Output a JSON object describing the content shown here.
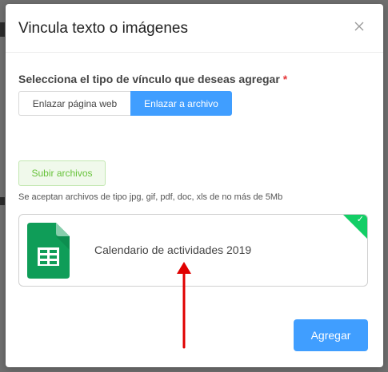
{
  "modal": {
    "title": "Vincula texto o imágenes",
    "close_icon": "close-icon"
  },
  "link_type": {
    "label": "Selecciona el tipo de vínculo que deseas agregar",
    "required_mark": "*",
    "options": [
      "Enlazar página web",
      "Enlazar a archivo"
    ],
    "selected": "Enlazar a archivo"
  },
  "upload": {
    "button_label": "Subir archivos",
    "hint": "Se aceptan archivos de tipo jpg, gif, pdf, doc, xls de no más de 5Mb"
  },
  "file": {
    "name": "Calendario de actividades 2019",
    "icon": "spreadsheet-file-icon",
    "status_icon": "check-icon",
    "selected": true
  },
  "footer": {
    "submit_label": "Agregar"
  },
  "colors": {
    "primary": "#409eff",
    "success": "#13ce66",
    "upload_text": "#67c23a",
    "sheet_green": "#0f9d58",
    "required": "#e5383b",
    "annotation_arrow": "#e00000"
  }
}
